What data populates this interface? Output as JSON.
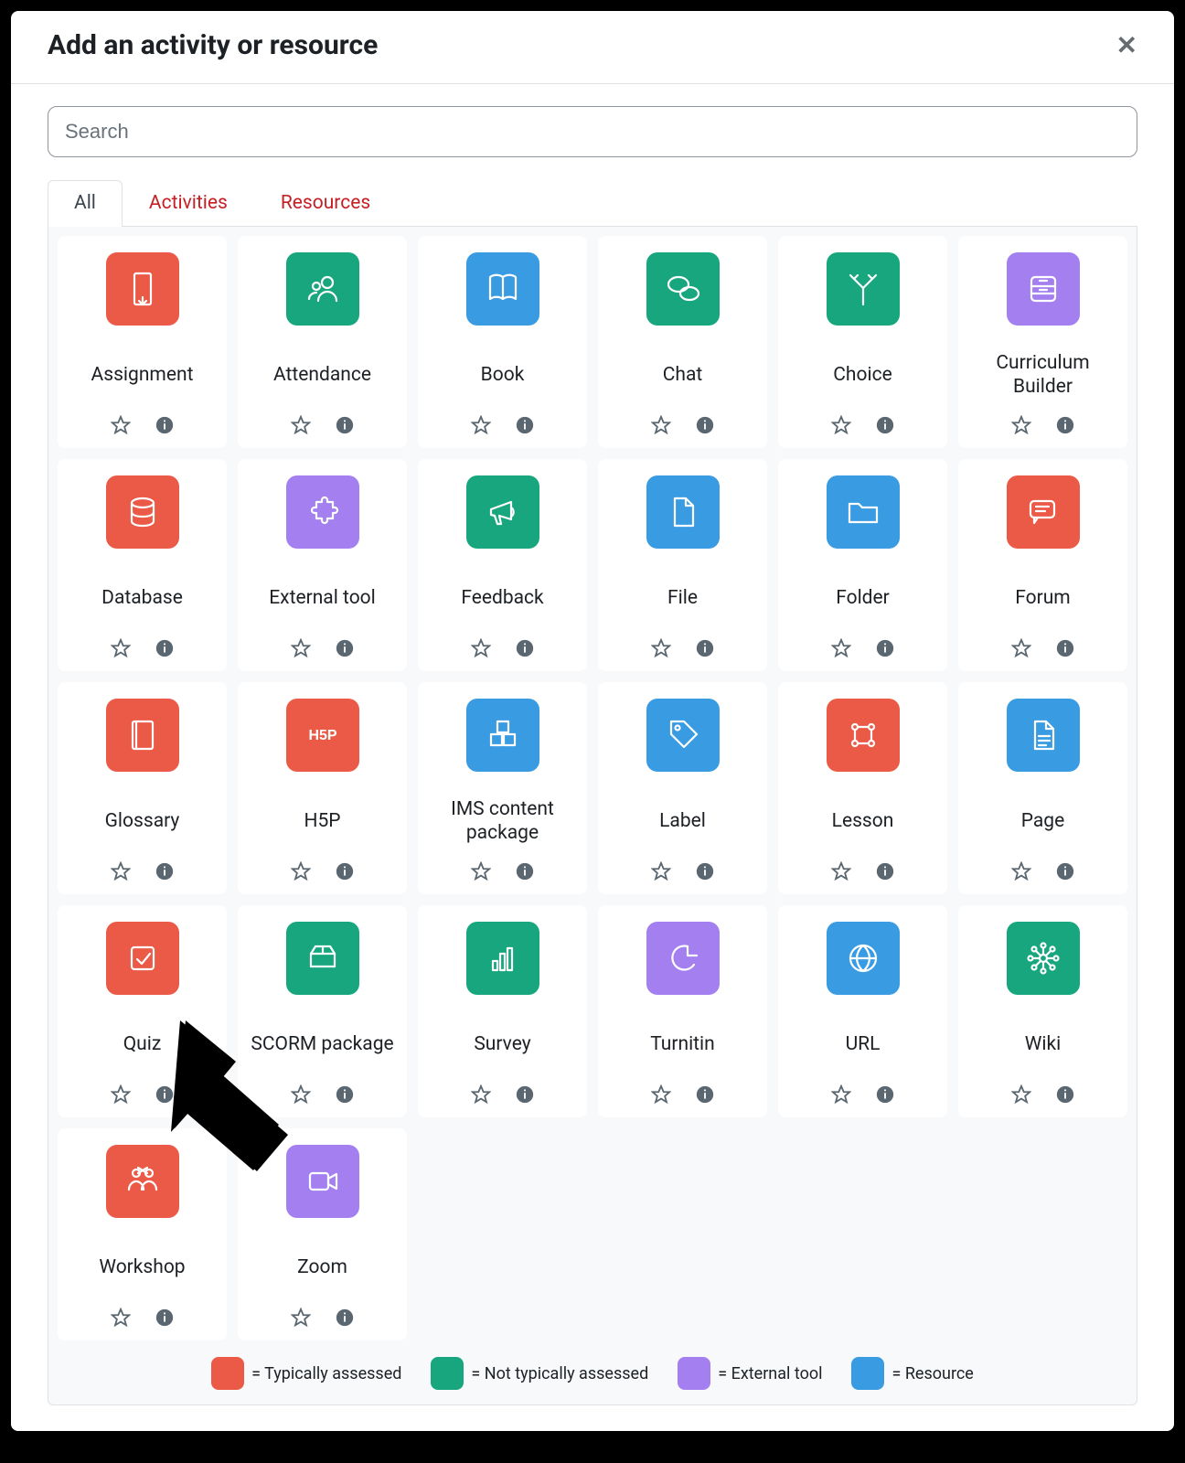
{
  "modal": {
    "title": "Add an activity or resource",
    "close_label": "Close"
  },
  "search": {
    "placeholder": "Search",
    "value": ""
  },
  "tabs": [
    {
      "label": "All",
      "active": true
    },
    {
      "label": "Activities",
      "active": false
    },
    {
      "label": "Resources",
      "active": false
    }
  ],
  "colors": {
    "red": "#eb5a46",
    "green": "#17a67e",
    "blue": "#399be2",
    "purple": "#a37ff0"
  },
  "items": [
    {
      "label": "Assignment",
      "color": "red",
      "icon": "assignment"
    },
    {
      "label": "Attendance",
      "color": "green",
      "icon": "attendance"
    },
    {
      "label": "Book",
      "color": "blue",
      "icon": "book"
    },
    {
      "label": "Chat",
      "color": "green",
      "icon": "chat"
    },
    {
      "label": "Choice",
      "color": "green",
      "icon": "choice"
    },
    {
      "label": "Curriculum Builder",
      "color": "purple",
      "icon": "curriculum"
    },
    {
      "label": "Database",
      "color": "red",
      "icon": "database"
    },
    {
      "label": "External tool",
      "color": "purple",
      "icon": "puzzle"
    },
    {
      "label": "Feedback",
      "color": "green",
      "icon": "megaphone"
    },
    {
      "label": "File",
      "color": "blue",
      "icon": "file"
    },
    {
      "label": "Folder",
      "color": "blue",
      "icon": "folder"
    },
    {
      "label": "Forum",
      "color": "red",
      "icon": "forum"
    },
    {
      "label": "Glossary",
      "color": "red",
      "icon": "glossary"
    },
    {
      "label": "H5P",
      "color": "red",
      "icon": "h5p"
    },
    {
      "label": "IMS content package",
      "color": "blue",
      "icon": "ims"
    },
    {
      "label": "Label",
      "color": "blue",
      "icon": "tag"
    },
    {
      "label": "Lesson",
      "color": "red",
      "icon": "lesson"
    },
    {
      "label": "Page",
      "color": "blue",
      "icon": "page"
    },
    {
      "label": "Quiz",
      "color": "red",
      "icon": "quiz"
    },
    {
      "label": "SCORM package",
      "color": "green",
      "icon": "scorm"
    },
    {
      "label": "Survey",
      "color": "green",
      "icon": "survey"
    },
    {
      "label": "Turnitin",
      "color": "purple",
      "icon": "turnitin"
    },
    {
      "label": "URL",
      "color": "blue",
      "icon": "url"
    },
    {
      "label": "Wiki",
      "color": "green",
      "icon": "wiki"
    },
    {
      "label": "Workshop",
      "color": "red",
      "icon": "workshop"
    },
    {
      "label": "Zoom",
      "color": "purple",
      "icon": "zoom"
    }
  ],
  "legend": [
    {
      "color": "red",
      "label": "= Typically assessed"
    },
    {
      "color": "green",
      "label": "= Not typically assessed"
    },
    {
      "color": "purple",
      "label": "= External tool"
    },
    {
      "color": "blue",
      "label": "= Resource"
    }
  ],
  "annotation": {
    "arrow_points_to": "Quiz"
  }
}
